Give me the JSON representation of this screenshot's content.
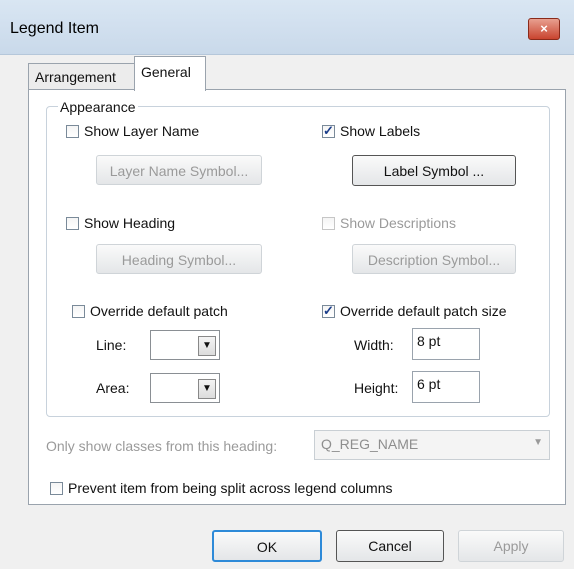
{
  "window": {
    "title": "Legend Item",
    "close_glyph": "×"
  },
  "tabs": [
    {
      "label": "Arrangement"
    },
    {
      "label": "General"
    }
  ],
  "appearance": {
    "label": "Appearance",
    "show_layer_name": {
      "label": "Show Layer Name",
      "checked": false
    },
    "layer_name_symbol": "Layer Name Symbol...",
    "show_labels": {
      "label": "Show Labels",
      "checked": true
    },
    "label_symbol": "Label Symbol ...",
    "show_heading": {
      "label": "Show Heading",
      "checked": false
    },
    "heading_symbol": "Heading Symbol...",
    "show_descriptions": {
      "label": "Show Descriptions",
      "checked": false
    },
    "description_symbol": "Description Symbol...",
    "override_patch": {
      "label": "Override default patch",
      "checked": false
    },
    "line_label": "Line:",
    "area_label": "Area:",
    "override_patch_size": {
      "label": "Override default patch size",
      "checked": true
    },
    "width_label": "Width:",
    "width_value": "8 pt",
    "height_label": "Height:",
    "height_value": "6 pt"
  },
  "only_show": {
    "label": "Only show classes from this heading:",
    "value": "Q_REG_NAME"
  },
  "prevent_split": {
    "label": "Prevent item from being split across legend columns",
    "checked": false
  },
  "buttons": {
    "ok": "OK",
    "cancel": "Cancel",
    "apply": "Apply"
  },
  "colors": {
    "title_bar": "#d3e2f1",
    "close": "#c9442f",
    "default_button_border": "#2e8ad8"
  }
}
